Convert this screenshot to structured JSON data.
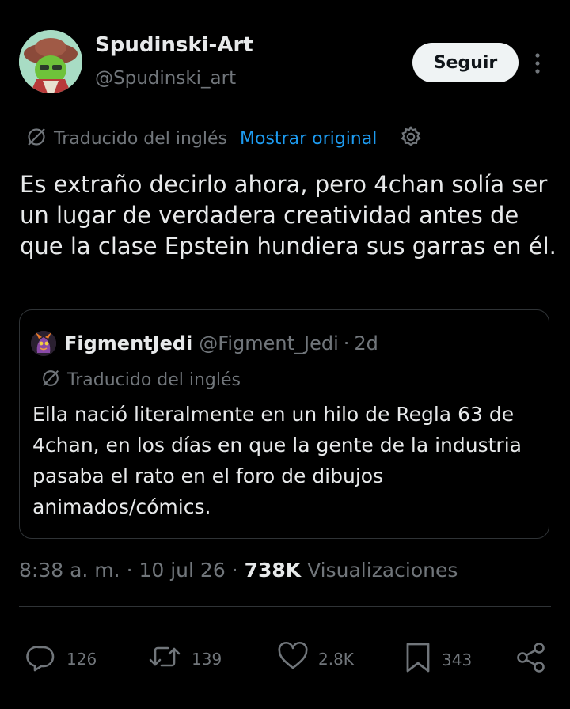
{
  "author": {
    "name": "Spudinski-Art",
    "handle": "@Spudinski_art",
    "follow_label": "Seguir"
  },
  "translation": {
    "label": "Traducido del inglés",
    "show_original": "Mostrar original"
  },
  "tweet": {
    "text": "Es extraño decirlo ahora, pero 4chan solía ser un lugar de verdadera creatividad antes de que la clase Epstein hundiera sus garras en él."
  },
  "quote": {
    "name": "FigmentJedi",
    "handle": "@Figment_Jedi",
    "separator": "·",
    "time": "2d",
    "translation_label": "Traducido del inglés",
    "text": "Ella nació literalmente en un hilo de Regla 63 de 4chan, en los días en que la gente de la industria pasaba el rato en el foro de dibujos animados/cómics."
  },
  "meta": {
    "time": "8:38 a. m.",
    "date": "10 jul 26",
    "views_count": "738K",
    "views_label": "Visualizaciones",
    "separator": "·"
  },
  "actions": {
    "replies": "126",
    "reposts": "139",
    "likes": "2.8K",
    "bookmarks": "343"
  },
  "colors": {
    "background": "#000000",
    "text": "#e7e9ea",
    "secondary": "#71767b",
    "link": "#1d9bf0",
    "border": "#2f3336"
  },
  "icons": [
    "more-icon",
    "translate-icon",
    "gear-icon",
    "reply-icon",
    "repost-icon",
    "like-icon",
    "bookmark-icon",
    "share-icon"
  ]
}
